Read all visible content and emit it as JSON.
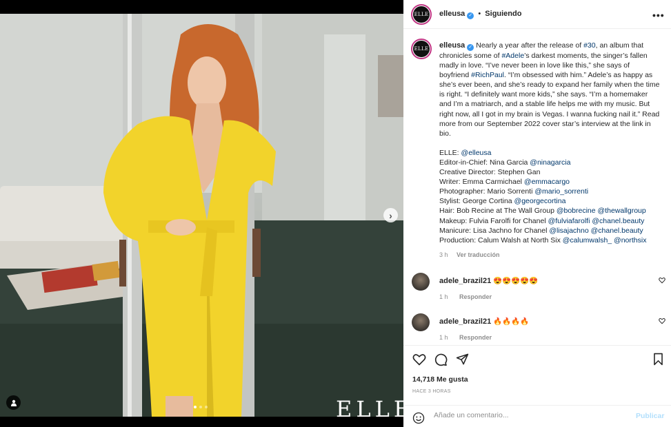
{
  "header": {
    "avatar_text": "ELLE",
    "username": "elleusa",
    "separator": "•",
    "follow_label": "Siguiendo"
  },
  "media": {
    "watermark": "ELLE",
    "carousel_index": 1,
    "carousel_count": 3
  },
  "caption": {
    "username": "elleusa",
    "paragraph_parts": [
      {
        "text": "Nearly a year after the release of ",
        "link": false
      },
      {
        "text": "#30",
        "link": true
      },
      {
        "text": ", an album that chronicles some of ",
        "link": false
      },
      {
        "text": "#Adele",
        "link": true
      },
      {
        "text": "’s darkest moments, the singer’s fallen madly in love. “I’ve never been in love like this,” she says of boyfriend ",
        "link": false
      },
      {
        "text": "#RichPaul",
        "link": true
      },
      {
        "text": ". “I’m obsessed with him.” Adele’s as happy as she’s ever been, and she’s ready to expand her family when the time is right. “I definitely want more kids,” she says. “I’m a homemaker and I’m a matriarch, and a stable life helps me with my music. But right now, all I got in my brain is Vegas. I wanna fucking nail it.” Read more from our September 2022 cover star’s interview at the link in bio.",
        "link": false
      }
    ],
    "credits": [
      [
        {
          "text": "ELLE: ",
          "link": false
        },
        {
          "text": "@elleusa",
          "link": true
        }
      ],
      [
        {
          "text": "Editor-in-Chief: Nina Garcia ",
          "link": false
        },
        {
          "text": "@ninagarcia",
          "link": true
        }
      ],
      [
        {
          "text": "Creative Director: Stephen Gan",
          "link": false
        }
      ],
      [
        {
          "text": "Writer: Emma Carmichael ",
          "link": false
        },
        {
          "text": "@emmacargo",
          "link": true
        }
      ],
      [
        {
          "text": "Photographer: Mario Sorrenti ",
          "link": false
        },
        {
          "text": "@mario_sorrenti",
          "link": true
        }
      ],
      [
        {
          "text": "Stylist: George Cortina ",
          "link": false
        },
        {
          "text": "@georgecortina",
          "link": true
        }
      ],
      [
        {
          "text": "Hair: Bob Recine at The Wall Group ",
          "link": false
        },
        {
          "text": "@bobrecine",
          "link": true
        },
        {
          "text": " ",
          "link": false
        },
        {
          "text": "@thewallgroup",
          "link": true
        }
      ],
      [
        {
          "text": "Makeup: Fulvia Farolfi for Chanel ",
          "link": false
        },
        {
          "text": "@fulviafarolfi",
          "link": true
        },
        {
          "text": " ",
          "link": false
        },
        {
          "text": "@chanel.beauty",
          "link": true
        }
      ],
      [
        {
          "text": "Manicure: Lisa Jachno for Chanel ",
          "link": false
        },
        {
          "text": "@lisajachno",
          "link": true
        },
        {
          "text": " ",
          "link": false
        },
        {
          "text": "@chanel.beauty",
          "link": true
        }
      ],
      [
        {
          "text": "Production: Calum Walsh at North Six ",
          "link": false
        },
        {
          "text": "@calumwalsh_",
          "link": true
        },
        {
          "text": " ",
          "link": false
        },
        {
          "text": "@northsix",
          "link": true
        }
      ]
    ],
    "time": "3 h",
    "translate_label": "Ver traducción"
  },
  "comments": [
    {
      "username": "adele_brazil21",
      "text": "😍😍😍😍😍",
      "time": "1 h",
      "reply_label": "Responder"
    },
    {
      "username": "adele_brazil21",
      "text": "🔥🔥🔥🔥",
      "time": "1 h",
      "reply_label": "Responder"
    }
  ],
  "actions": {
    "likes": "14,718 Me gusta",
    "time_ago": "HACE 3 HORAS"
  },
  "comment_bar": {
    "placeholder": "Añade un comentario...",
    "publish_label": "Publicar"
  },
  "colors": {
    "link": "#00376b",
    "muted": "#8e8e8e",
    "publish_disabled": "#b2dffc",
    "verified": "#3897f0",
    "coat": "#f2d32b"
  },
  "icons": [
    "more-icon",
    "verified-icon",
    "chevron-right-icon",
    "user-tag-icon",
    "heart-icon",
    "comment-icon",
    "share-icon",
    "bookmark-icon",
    "emoji-icon"
  ]
}
